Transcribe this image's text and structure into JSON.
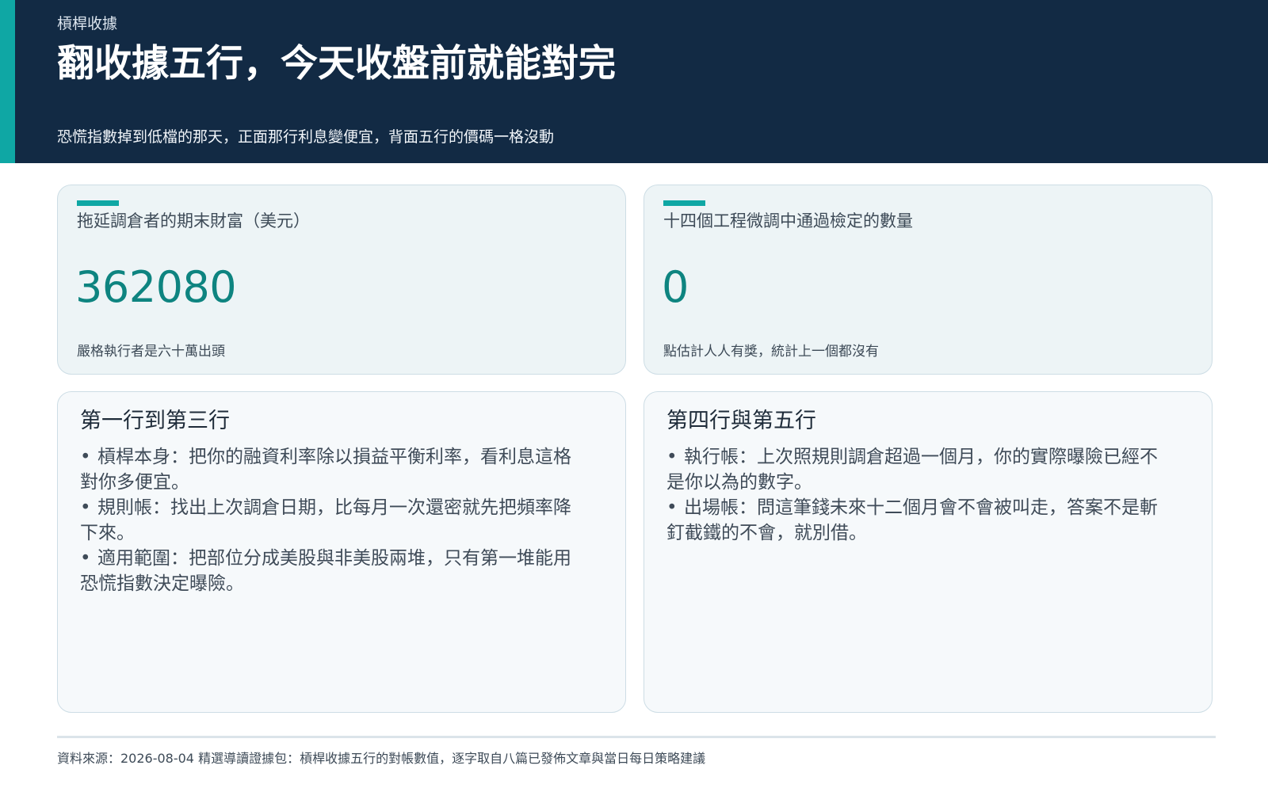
{
  "header": {
    "eyebrow": "槓桿收據",
    "title": "翻收據五行，今天收盤前就能對完",
    "subtitle": "恐慌指數掉到低檔的那天，正面那行利息變便宜，背面五行的價碼一格沒動",
    "accent_color": "#0fa7a4",
    "background_color": "#122a44"
  },
  "kpis": [
    {
      "label": "拖延調倉者的期末財富（美元）",
      "value": "362080",
      "note": "嚴格執行者是六十萬出頭"
    },
    {
      "label": "十四個工程微調中通過檢定的數量",
      "value": "0",
      "note": "點估計人人有獎，統計上一個都沒有"
    }
  ],
  "panels": [
    {
      "title": "第一行到第三行",
      "items": [
        "槓桿本身：把你的融資利率除以損益平衡利率，看利息這格對你多便宜。",
        "規則帳：找出上次調倉日期，比每月一次還密就先把頻率降下來。",
        "適用範圍：把部位分成美股與非美股兩堆，只有第一堆能用恐慌指數決定曝險。"
      ]
    },
    {
      "title": "第四行與第五行",
      "items": [
        "執行帳：上次照規則調倉超過一個月，你的實際曝險已經不是你以為的數字。",
        "出場帳：問這筆錢未來十二個月會不會被叫走，答案不是斬釘截鐵的不會，就別借。"
      ]
    }
  ],
  "bullet_symbol": "•",
  "footer": {
    "source": "資料來源：2026-08-04 精選導讀證據包：槓桿收據五行的對帳數值，逐字取自八篇已發佈文章與當日每日策略建議"
  }
}
